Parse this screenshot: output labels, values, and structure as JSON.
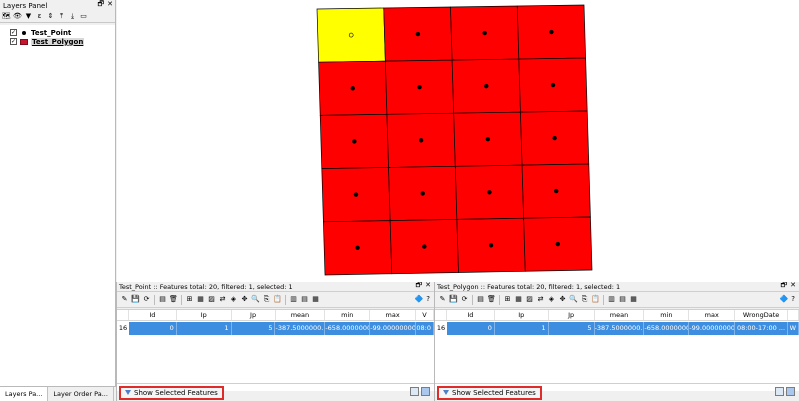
{
  "layers_panel": {
    "title": "Layers Panel",
    "float_glyph": "🗗",
    "close_glyph": "✕",
    "toolbar_icons": [
      "🗺",
      "👁",
      "▼",
      "ε",
      "⇕",
      "⤒",
      "⤓",
      "▭"
    ],
    "layers": [
      {
        "name": "Test_Point",
        "checked": "✓",
        "selected": false
      },
      {
        "name": "Test_Polygon",
        "checked": "✓",
        "selected": true
      }
    ],
    "tabs": [
      "Layers Pa...",
      "Layer Order Pa..."
    ]
  },
  "map": {
    "fill_color": "#ff0000",
    "selected_color": "#ffff00",
    "grid_cols": 4,
    "grid_rows": 5
  },
  "attr_point": {
    "title": "Test_Point :: Features total: 20, filtered: 1, selected: 1",
    "columns": [
      "Id",
      "Ip",
      "Jp",
      "mean",
      "min",
      "max",
      "V"
    ],
    "row_number": "16",
    "row": [
      "0",
      "1",
      "5",
      "-387.5000000...",
      "-658.0000000...",
      "-99.00000000...",
      "08:0"
    ],
    "footer_button": "Show Selected Features"
  },
  "attr_poly": {
    "title": "Test_Polygon :: Features total: 20, filtered: 1, selected: 1",
    "columns": [
      "Id",
      "Ip",
      "Jp",
      "mean",
      "min",
      "max",
      "WrongDate"
    ],
    "row_number": "16",
    "row": [
      "0",
      "1",
      "5",
      "-387.5000000...",
      "-658.0000000...",
      "-99.00000000...",
      "08:00-17:00 ...",
      "W"
    ],
    "footer_button": "Show Selected Features"
  },
  "toolbar_icons": [
    "✎",
    "💾",
    "⟳",
    "▤",
    "🗑",
    "⊞",
    "▦",
    "▨",
    "⇄",
    "◈",
    "✥",
    "🔍",
    "⎘",
    "📋",
    "▥",
    "▤",
    "▦"
  ],
  "right_icon": "🔷",
  "help_glyph": "?",
  "scroll_left": "<",
  "scroll_right": ">"
}
